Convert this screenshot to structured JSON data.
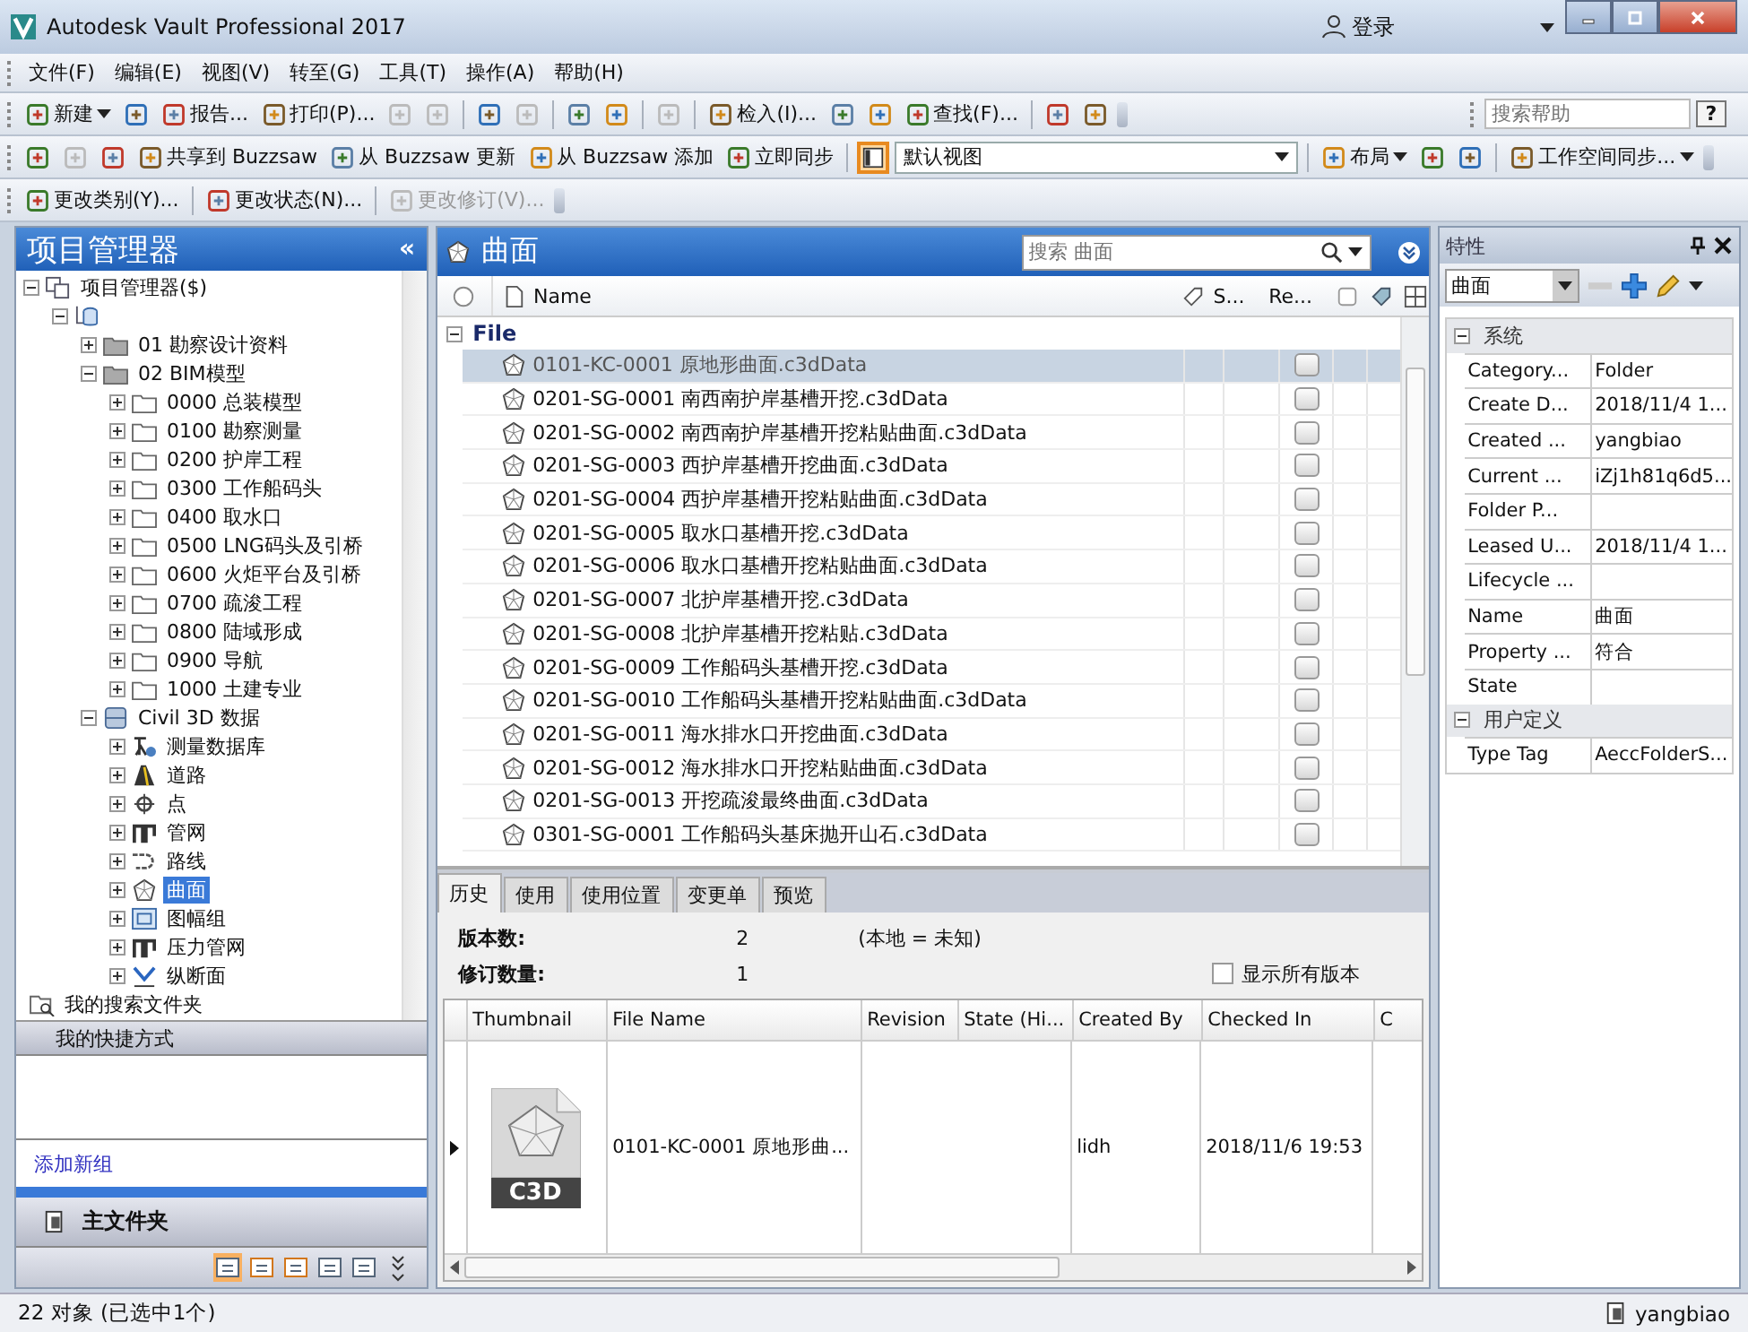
{
  "window": {
    "title": "Autodesk Vault Professional 2017",
    "user": "登录"
  },
  "menu": [
    "文件(F)",
    "编辑(E)",
    "视图(V)",
    "转至(G)",
    "工具(T)",
    "操作(A)",
    "帮助(H)"
  ],
  "toolbars": [
    [
      {
        "kind": "menu-button",
        "label": "新建",
        "disabled": false
      },
      {
        "kind": "button",
        "disabled": false
      },
      {
        "kind": "button",
        "label": "报告...",
        "disabled": false
      },
      {
        "kind": "button",
        "label": "打印(P)...",
        "disabled": false
      },
      {
        "kind": "button",
        "disabled": true
      },
      {
        "kind": "button",
        "disabled": true
      },
      {
        "kind": "separator"
      },
      {
        "kind": "button",
        "disabled": false
      },
      {
        "kind": "button",
        "disabled": true
      },
      {
        "kind": "separator"
      },
      {
        "kind": "button",
        "disabled": false
      },
      {
        "kind": "button",
        "disabled": false
      },
      {
        "kind": "separator"
      },
      {
        "kind": "button",
        "disabled": true
      },
      {
        "kind": "separator"
      },
      {
        "kind": "button",
        "label": "检入(I)...",
        "disabled": false
      },
      {
        "kind": "button",
        "disabled": false
      },
      {
        "kind": "button",
        "disabled": false
      },
      {
        "kind": "button",
        "label": "查找(F)...",
        "disabled": false
      },
      {
        "kind": "separator"
      },
      {
        "kind": "button",
        "disabled": false
      },
      {
        "kind": "button",
        "disabled": false
      }
    ],
    [
      {
        "kind": "button",
        "disabled": false
      },
      {
        "kind": "button",
        "disabled": true
      },
      {
        "kind": "button",
        "disabled": false
      },
      {
        "kind": "button",
        "label": "共享到 Buzzsaw",
        "disabled": false
      },
      {
        "kind": "button",
        "label": "从 Buzzsaw 更新",
        "disabled": false
      },
      {
        "kind": "button",
        "label": "从 Buzzsaw 添加",
        "disabled": false
      },
      {
        "kind": "button",
        "label": "立即同步",
        "disabled": false
      },
      {
        "kind": "separator"
      },
      {
        "kind": "toggle",
        "on": true
      },
      {
        "kind": "combo",
        "label": "默认视图"
      },
      {
        "kind": "separator"
      },
      {
        "kind": "menu-button",
        "label": "布局",
        "disabled": false
      },
      {
        "kind": "button",
        "disabled": false
      },
      {
        "kind": "button",
        "disabled": false
      },
      {
        "kind": "separator"
      },
      {
        "kind": "menu-button",
        "label": "工作空间同步...",
        "disabled": false
      }
    ],
    [
      {
        "kind": "button",
        "label": "更改类别(Y)...",
        "disabled": false
      },
      {
        "kind": "separator"
      },
      {
        "kind": "button",
        "label": "更改状态(N)...",
        "disabled": false
      },
      {
        "kind": "separator"
      },
      {
        "kind": "button",
        "label": "更改修订(V)...",
        "disabled": true
      }
    ]
  ],
  "help_search": {
    "placeholder": "搜索帮助",
    "button": "?"
  },
  "navigator": {
    "title": "项目管理器",
    "collapse": "«",
    "tree": [
      {
        "label": "项目管理器($)",
        "kind": "vault",
        "expanded": true,
        "selected": false,
        "children": [
          {
            "kind": "server",
            "expanded": true,
            "selected": false,
            "children": [
              {
                "label": "01 勘察设计资料",
                "kind": "folder-dark",
                "expanded": false,
                "selected": false
              },
              {
                "label": "02 BIM模型",
                "kind": "folder-dark",
                "expanded": true,
                "selected": false,
                "children": [
                  {
                    "label": "0000 总装模型",
                    "kind": "folder",
                    "expanded": false,
                    "selected": false
                  },
                  {
                    "label": "0100 勘察测量",
                    "kind": "folder",
                    "expanded": false,
                    "selected": false
                  },
                  {
                    "label": "0200 护岸工程",
                    "kind": "folder",
                    "expanded": false,
                    "selected": false
                  },
                  {
                    "label": "0300 工作船码头",
                    "kind": "folder",
                    "expanded": false,
                    "selected": false
                  },
                  {
                    "label": "0400 取水口",
                    "kind": "folder",
                    "expanded": false,
                    "selected": false
                  },
                  {
                    "label": "0500 LNG码头及引桥",
                    "kind": "folder",
                    "expanded": false,
                    "selected": false
                  },
                  {
                    "label": "0600 火炬平台及引桥",
                    "kind": "folder",
                    "expanded": false,
                    "selected": false
                  },
                  {
                    "label": "0700 疏浚工程",
                    "kind": "folder",
                    "expanded": false,
                    "selected": false
                  },
                  {
                    "label": "0800 陆域形成",
                    "kind": "folder",
                    "expanded": false,
                    "selected": false
                  },
                  {
                    "label": "0900 导航",
                    "kind": "folder",
                    "expanded": false,
                    "selected": false
                  },
                  {
                    "label": "1000 土建专业",
                    "kind": "folder",
                    "expanded": false,
                    "selected": false
                  }
                ]
              },
              {
                "label": "Civil 3D 数据",
                "kind": "database",
                "expanded": true,
                "selected": false,
                "children": [
                  {
                    "label": "测量数据库",
                    "kind": "survey",
                    "expanded": false,
                    "selected": false
                  },
                  {
                    "label": "道路",
                    "kind": "road",
                    "expanded": false,
                    "selected": false
                  },
                  {
                    "label": "点",
                    "kind": "point",
                    "expanded": false,
                    "selected": false
                  },
                  {
                    "label": "管网",
                    "kind": "pipe",
                    "expanded": false,
                    "selected": false
                  },
                  {
                    "label": "路线",
                    "kind": "alignment",
                    "expanded": false,
                    "selected": false
                  },
                  {
                    "label": "曲面",
                    "kind": "surface",
                    "expanded": false,
                    "selected": true
                  },
                  {
                    "label": "图幅组",
                    "kind": "sheet",
                    "expanded": false,
                    "selected": false
                  },
                  {
                    "label": "压力管网",
                    "kind": "pipe",
                    "expanded": false,
                    "selected": false
                  },
                  {
                    "label": "纵断面",
                    "kind": "profile",
                    "expanded": false,
                    "selected": false
                  }
                ]
              }
            ]
          }
        ]
      },
      {
        "label": "我的搜索文件夹",
        "kind": "search",
        "selected": false
      }
    ],
    "shortcuts": {
      "title": "我的快捷方式",
      "add_group": "添加新组"
    },
    "home": "主文件夹"
  },
  "list": {
    "title": "曲面",
    "search_placeholder": "搜索 曲面",
    "columns": [
      "Name",
      "S...",
      "Re..."
    ],
    "group": {
      "label": "File",
      "expanded": true
    },
    "rows": [
      {
        "name": "0101-KC-0001 原地形曲面.c3dData",
        "selected": true
      },
      {
        "name": "0201-SG-0001 南西南护岸基槽开挖.c3dData",
        "selected": false
      },
      {
        "name": "0201-SG-0002 南西南护岸基槽开挖粘贴曲面.c3dData",
        "selected": false
      },
      {
        "name": "0201-SG-0003 西护岸基槽开挖曲面.c3dData",
        "selected": false
      },
      {
        "name": "0201-SG-0004 西护岸基槽开挖粘贴曲面.c3dData",
        "selected": false
      },
      {
        "name": "0201-SG-0005 取水口基槽开挖.c3dData",
        "selected": false
      },
      {
        "name": "0201-SG-0006 取水口基槽开挖粘贴曲面.c3dData",
        "selected": false
      },
      {
        "name": "0201-SG-0007 北护岸基槽开挖.c3dData",
        "selected": false
      },
      {
        "name": "0201-SG-0008 北护岸基槽开挖粘贴.c3dData",
        "selected": false
      },
      {
        "name": "0201-SG-0009 工作船码头基槽开挖.c3dData",
        "selected": false
      },
      {
        "name": "0201-SG-0010 工作船码头基槽开挖粘贴曲面.c3dData",
        "selected": false
      },
      {
        "name": "0201-SG-0011 海水排水口开挖曲面.c3dData",
        "selected": false
      },
      {
        "name": "0201-SG-0012 海水排水口开挖粘贴曲面.c3dData",
        "selected": false
      },
      {
        "name": "0201-SG-0013 开挖疏浚最终曲面.c3dData",
        "selected": false
      },
      {
        "name": "0301-SG-0001 工作船码头基床抛开山石.c3dData",
        "selected": false
      }
    ]
  },
  "details": {
    "tabs": [
      {
        "label": "历史",
        "selected": true
      },
      {
        "label": "使用",
        "selected": false
      },
      {
        "label": "使用位置",
        "selected": false
      },
      {
        "label": "变更单",
        "selected": false
      },
      {
        "label": "预览",
        "selected": false
      }
    ],
    "summary": [
      {
        "label": "版本数:",
        "value": "2",
        "note": "(本地 = 未知)"
      },
      {
        "label": "修订数量:",
        "value": "1"
      }
    ],
    "show_all": {
      "label": "显示所有版本",
      "checked": false
    },
    "columns": [
      "Thumbnail",
      "File Name",
      "Revision",
      "State (Hi...",
      "Created By",
      "Checked In",
      "C"
    ],
    "rows": [
      {
        "current": true,
        "thumbnail_label": "C3D",
        "file_name": "0101-KC-0001 原地形曲...",
        "created_by": "lidh",
        "checked_in": "2018/11/6 19:53"
      }
    ]
  },
  "properties": {
    "title": "特性",
    "combo": "曲面",
    "groups": [
      {
        "label": "系统",
        "expanded": true,
        "rows": [
          {
            "name": "Category...",
            "value": "Folder"
          },
          {
            "name": "Create D...",
            "value": "2018/11/4 1..."
          },
          {
            "name": "Created ...",
            "value": "yangbiao"
          },
          {
            "name": "Current ...",
            "value": "iZj1h81q6d5..."
          },
          {
            "name": "Folder P..."
          },
          {
            "name": "Leased U...",
            "value": "2018/11/4 1..."
          },
          {
            "name": "Lifecycle ..."
          },
          {
            "name": "Name",
            "value": "曲面"
          },
          {
            "name": "Property ...",
            "value": "符合"
          },
          {
            "name": "State"
          }
        ]
      },
      {
        "label": "用户定义",
        "expanded": true,
        "rows": [
          {
            "name": "Type Tag",
            "value": "AeccFolderS..."
          }
        ]
      }
    ]
  },
  "status_bar": {
    "text": "22 对象 (已选中1个)",
    "user": "yangbiao"
  }
}
